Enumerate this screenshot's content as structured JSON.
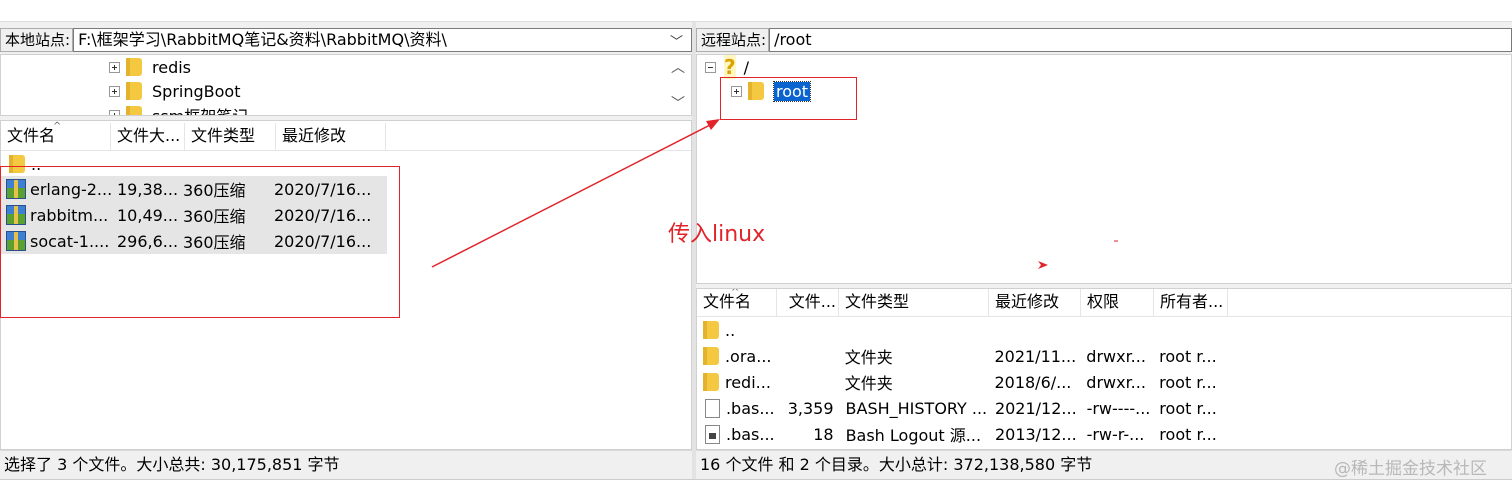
{
  "local": {
    "path_label": "本地站点:",
    "path_value": "F:\\框架学习\\RabbitMQ笔记&资料\\RabbitMQ\\资料\\",
    "tree": [
      "redis",
      "SpringBoot",
      "ssm框架笔记"
    ],
    "columns": [
      "文件名",
      "文件大...",
      "文件类型",
      "最近修改"
    ],
    "parent": "..",
    "files": [
      {
        "name": "erlang-2...",
        "size": "19,38...",
        "type": "360压缩",
        "modified": "2020/7/16..."
      },
      {
        "name": "rabbitm...",
        "size": "10,49...",
        "type": "360压缩",
        "modified": "2020/7/16..."
      },
      {
        "name": "socat-1....",
        "size": "296,6...",
        "type": "360压缩",
        "modified": "2020/7/16..."
      }
    ],
    "status": "选择了 3 个文件。大小总共: 30,175,851 字节"
  },
  "remote": {
    "path_label": "远程站点:",
    "path_value": "/root",
    "tree_root": "/",
    "tree_child": "root",
    "columns": [
      "文件名",
      "文件...",
      "文件类型",
      "最近修改",
      "权限",
      "所有者..."
    ],
    "parent": "..",
    "files": [
      {
        "name": ".ora...",
        "size": "",
        "type": "文件夹",
        "modified": "2021/11...",
        "perm": "drwxr...",
        "owner": "root r...",
        "icon": "folder-icon"
      },
      {
        "name": "redi...",
        "size": "",
        "type": "文件夹",
        "modified": "2018/6/...",
        "perm": "drwxr...",
        "owner": "root r...",
        "icon": "folder-icon"
      },
      {
        "name": ".bas...",
        "size": "3,359",
        "type": "BASH_HISTORY ...",
        "modified": "2021/12...",
        "perm": "-rw----...",
        "owner": "root r...",
        "icon": "file-icon"
      },
      {
        "name": ".bas...",
        "size": "18",
        "type": "Bash Logout 源...",
        "modified": "2013/12...",
        "perm": "-rw-r-...",
        "owner": "root r...",
        "icon": "script-file-icon"
      }
    ],
    "status": "16 个文件 和 2 个目录。大小总计: 372,138,580 字节"
  },
  "annotation": {
    "text": "传入linux",
    "color": "#e0242a"
  },
  "watermark": "@稀土掘金技术社区"
}
